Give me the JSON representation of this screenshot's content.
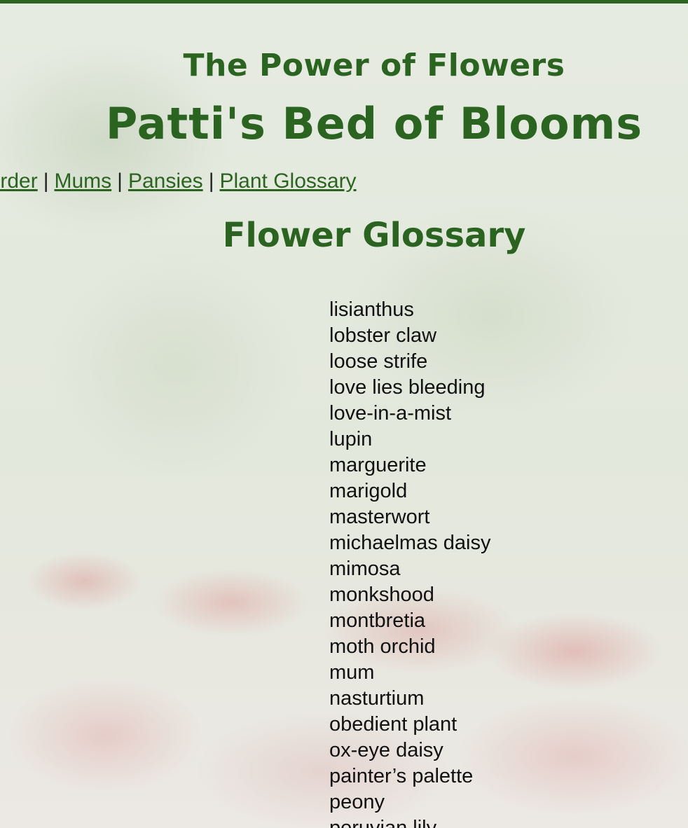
{
  "header": {
    "subtitle": "The Power of Flowers",
    "title": "Patti's Bed of Blooms"
  },
  "nav": {
    "items": [
      {
        "label": "Order",
        "partial_visible": "rder"
      },
      {
        "label": "Mums"
      },
      {
        "label": "Pansies"
      },
      {
        "label": "Plant Glossary"
      }
    ],
    "separator": "|"
  },
  "main": {
    "heading": "Flower Glossary",
    "glossary_items": [
      "lisianthus",
      "lobster claw",
      "loose strife",
      "love lies bleeding",
      "love-in-a-mist",
      "lupin",
      "marguerite",
      "marigold",
      "masterwort",
      "michaelmas daisy",
      "mimosa",
      "monkshood",
      "montbretia",
      "moth orchid",
      "mum",
      "nasturtium",
      "obedient plant",
      "ox-eye daisy",
      "painter’s palette",
      "peony",
      "peruvian lily"
    ]
  },
  "colors": {
    "accent": "#2b6420",
    "text": "#111111"
  }
}
